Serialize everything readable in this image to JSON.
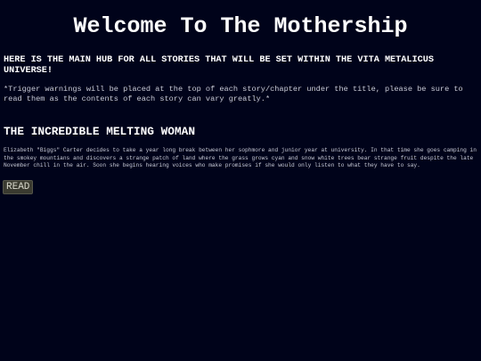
{
  "header": {
    "title": "Welcome To The Mothership"
  },
  "intro": {
    "heading": "HERE IS THE MAIN HUB FOR ALL STORIES THAT WILL BE SET WITHIN THE VITA METALICUS UNIVERSE!",
    "trigger_note": "*Trigger warnings will be placed at the top of each story/chapter under the title, please be sure to read them as the contents of each story can vary greatly.*"
  },
  "stories": [
    {
      "title": "THE INCREDIBLE MELTING WOMAN",
      "summary": "Elizabeth \"Biggs\" Carter decides to take a year long break between her sophmore and junior year at university. In that time she goes camping in the smokey mountians and discovers a strange patch of land where the grass grows cyan and snow white trees bear strange fruit despite the late November chill in the air. Soon she begins hearing voices who make promises if she would only listen to what they have to say.",
      "read_label": "READ"
    }
  ],
  "colors": {
    "background": "#00031a",
    "text": "#ffffff",
    "muted_text": "#c9cbd6",
    "button_bg": "#3a3a30"
  }
}
